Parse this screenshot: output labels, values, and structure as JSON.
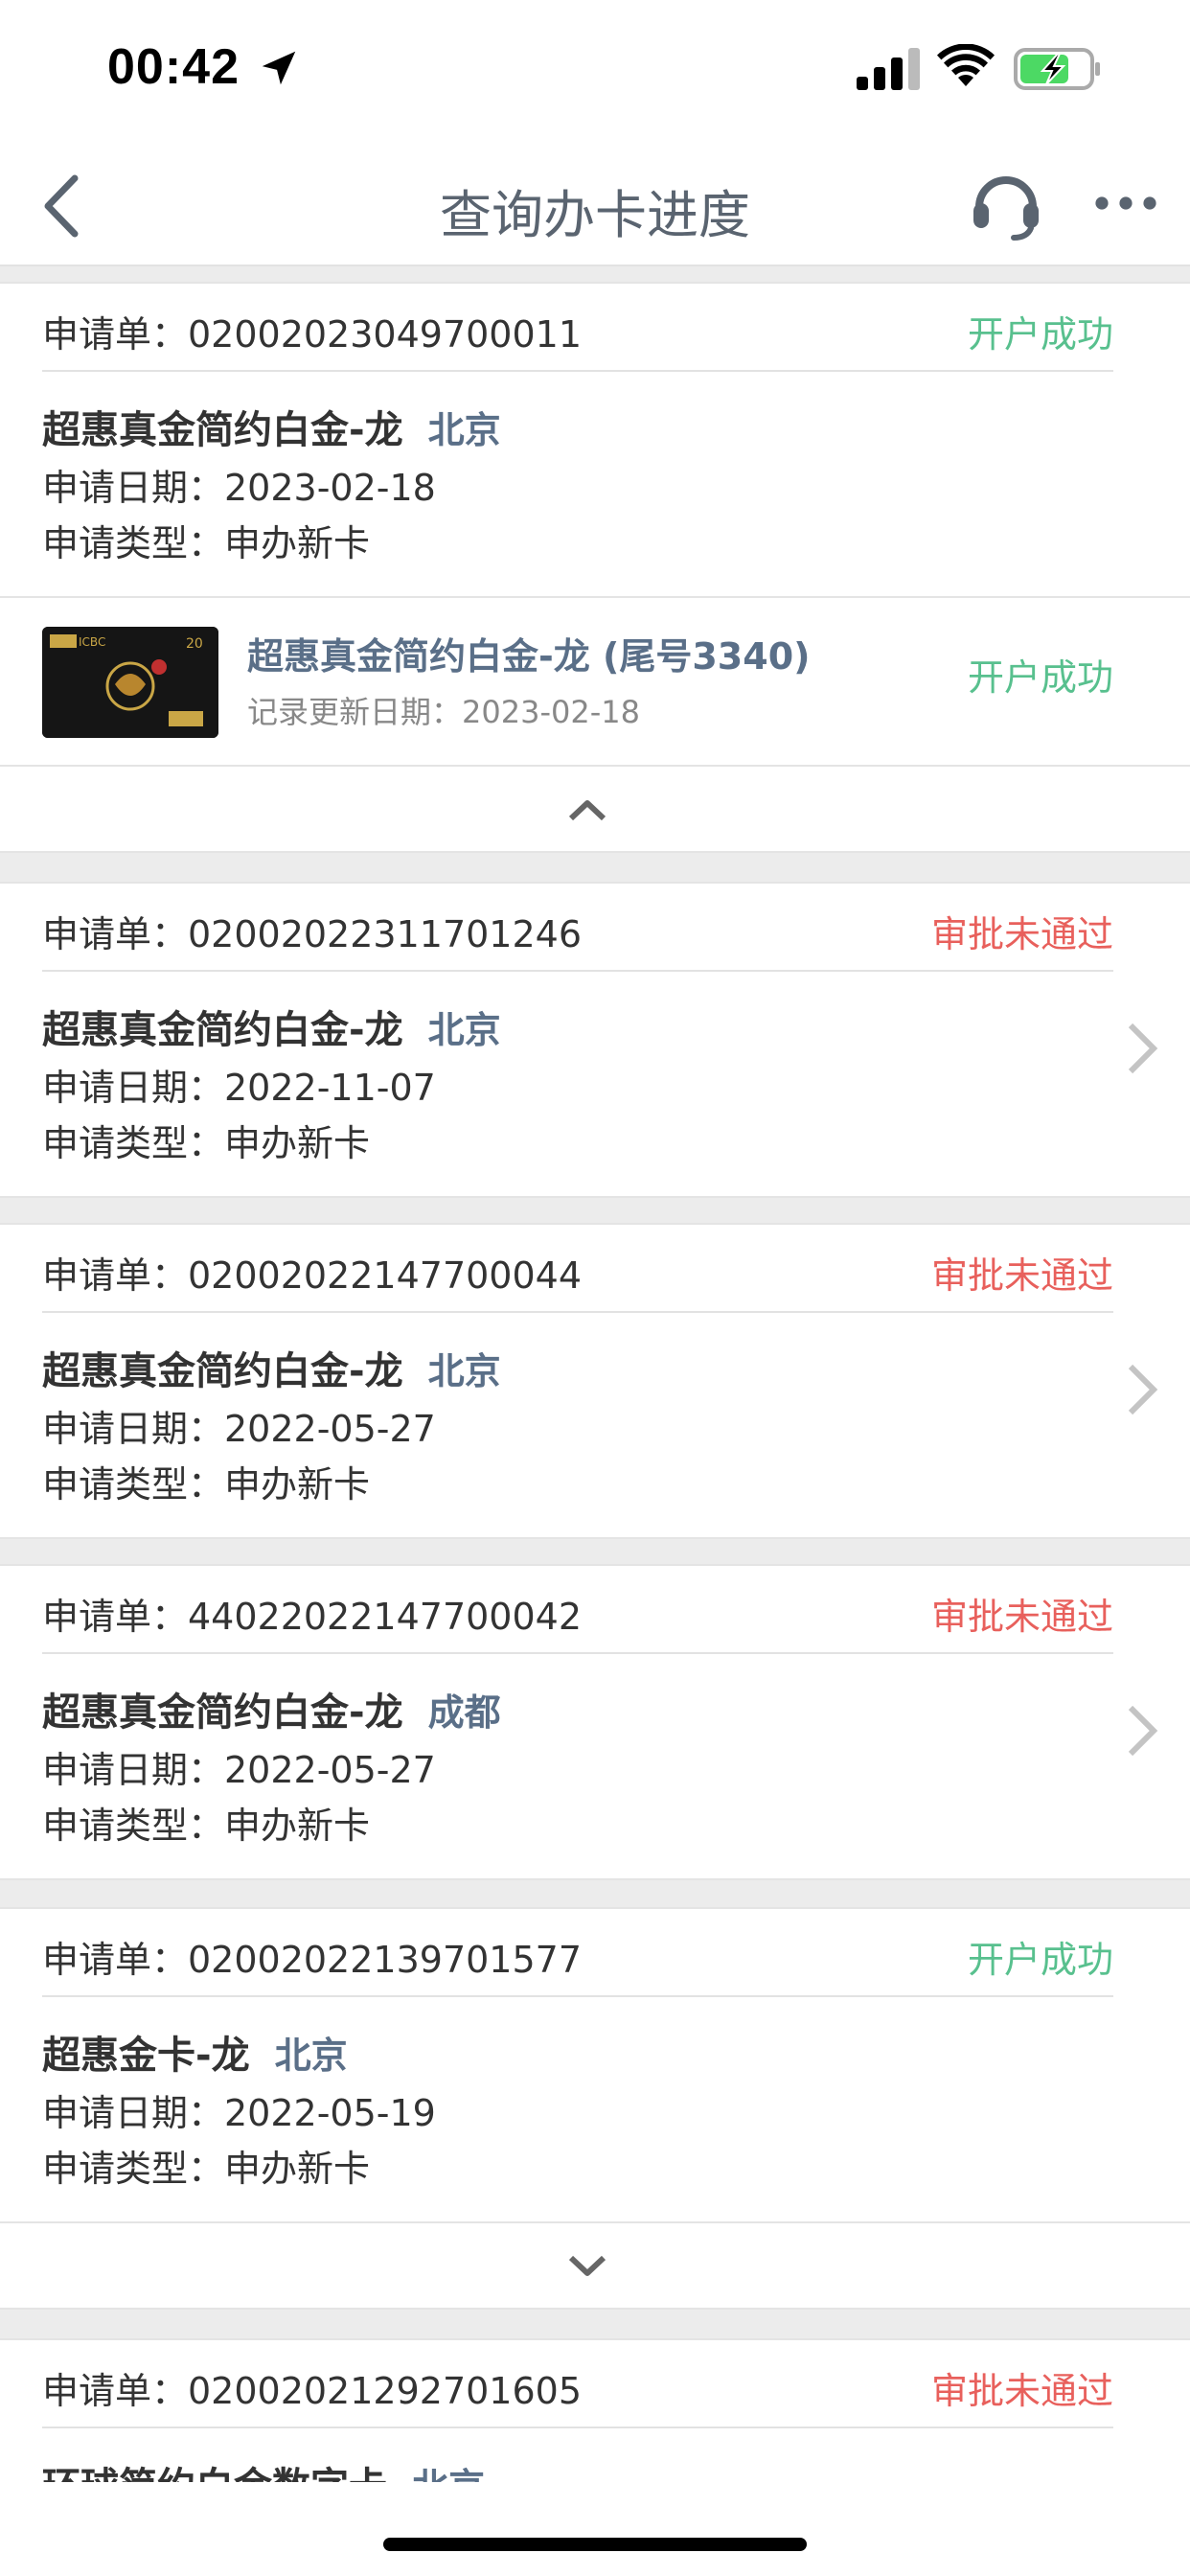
{
  "status_bar": {
    "time": "00:42"
  },
  "nav": {
    "title": "查询办卡进度"
  },
  "cards": [
    {
      "app_label": "申请单：02002023049700011",
      "status": "开户成功",
      "status_kind": "ok",
      "name": "超惠真金简约白金-龙",
      "city": "北京",
      "date": "申请日期：2023-02-18",
      "type": "申请类型：申办新卡"
    },
    {
      "app_label": "申请单：02002022311701246",
      "status": "审批未通过",
      "status_kind": "fail",
      "name": "超惠真金简约白金-龙",
      "city": "北京",
      "date": "申请日期：2022-11-07",
      "type": "申请类型：申办新卡"
    },
    {
      "app_label": "申请单：02002022147700044",
      "status": "审批未通过",
      "status_kind": "fail",
      "name": "超惠真金简约白金-龙",
      "city": "北京",
      "date": "申请日期：2022-05-27",
      "type": "申请类型：申办新卡"
    },
    {
      "app_label": "申请单：44022022147700042",
      "status": "审批未通过",
      "status_kind": "fail",
      "name": "超惠真金简约白金-龙",
      "city": "成都",
      "date": "申请日期：2022-05-27",
      "type": "申请类型：申办新卡"
    },
    {
      "app_label": "申请单：02002022139701577",
      "status": "开户成功",
      "status_kind": "ok",
      "name": "超惠金卡-龙",
      "city": "北京",
      "date": "申请日期：2022-05-19",
      "type": "申请类型：申办新卡"
    },
    {
      "app_label": "申请单：02002021292701605",
      "status": "审批未通过",
      "status_kind": "fail",
      "name": "环球简约白金数字卡",
      "city": "北京"
    }
  ],
  "card_detail": {
    "title": "超惠真金简约白金-龙 (尾号3340)",
    "updated": "记录更新日期：2023-02-18",
    "status": "开户成功",
    "thumb_text": "ICBC"
  },
  "colors": {
    "ok": "#58c08e",
    "fail": "#e8605c",
    "city": "#5a6f88"
  }
}
